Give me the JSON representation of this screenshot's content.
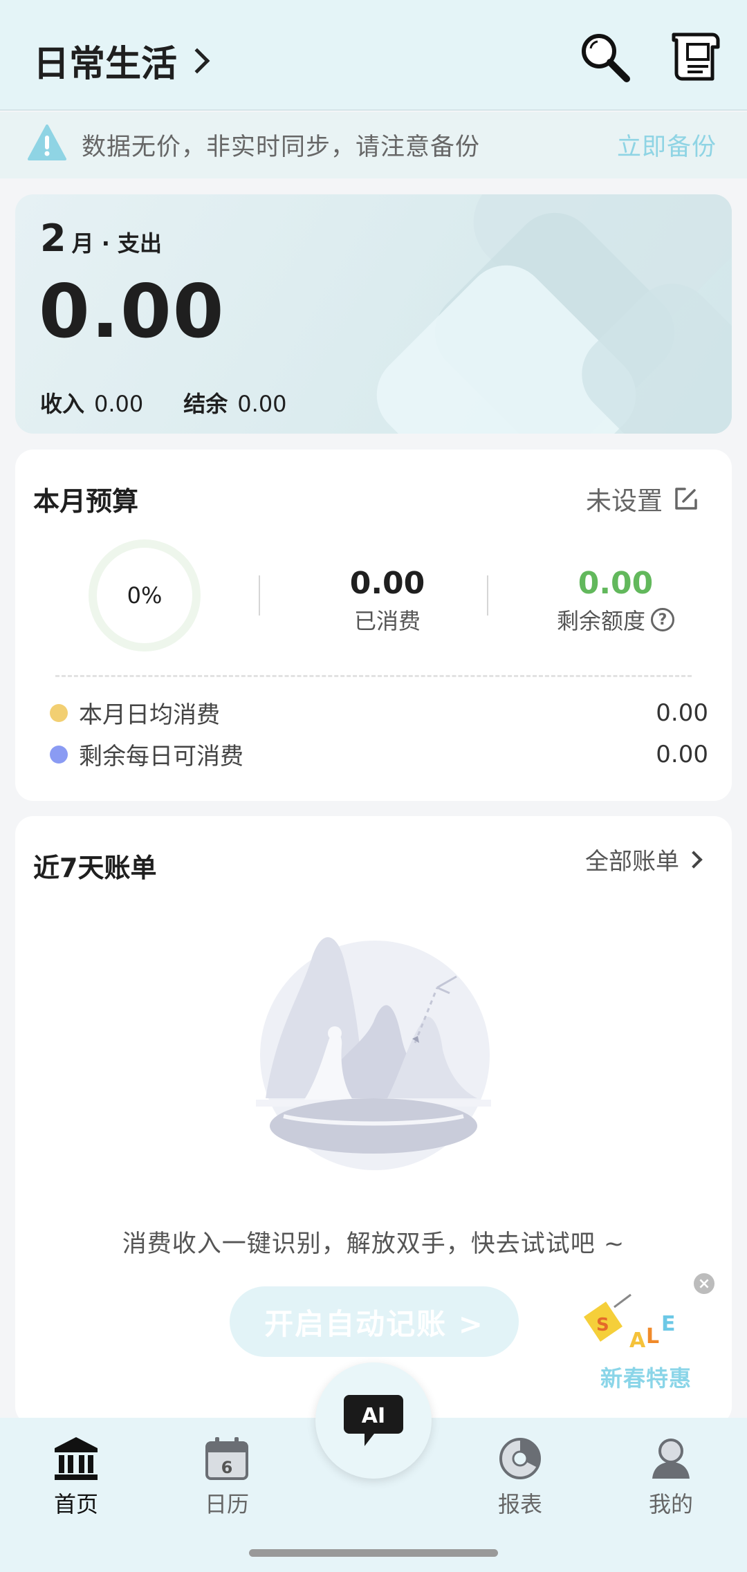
{
  "header": {
    "book_title": "日常生活"
  },
  "notice": {
    "text": "数据无价，非实时同步，请注意备份",
    "action": "立即备份"
  },
  "summary": {
    "month": "2",
    "month_label": "月 · 支出",
    "expense": "0.00",
    "income_label": "收入",
    "income": "0.00",
    "balance_label": "结余",
    "balance": "0.00"
  },
  "budget": {
    "title": "本月预算",
    "status": "未设置",
    "progress_percent": "0%",
    "spent": "0.00",
    "spent_label": "已消费",
    "remaining": "0.00",
    "remaining_label": "剩余额度",
    "help_glyph": "?",
    "rows": [
      {
        "label": "本月日均消费",
        "value": "0.00"
      },
      {
        "label": "剩余每日可消费",
        "value": "0.00"
      }
    ]
  },
  "bills": {
    "title": "近7天账单",
    "more": "全部账单",
    "empty_text": "消费收入一键识别，解放双手，快去试试吧 ~",
    "auto_button": "开启自动记账 >"
  },
  "promo": {
    "label": "新春特惠",
    "close": "×",
    "art_letters": [
      "S",
      "A",
      "L",
      "E"
    ]
  },
  "ai_button": {
    "label": "AI"
  },
  "tabs": [
    {
      "label": "首页",
      "icon": "bank-icon",
      "active": true
    },
    {
      "label": "日历",
      "icon": "calendar-icon",
      "day": "6"
    },
    {
      "label": "报表",
      "icon": "report-icon"
    },
    {
      "label": "我的",
      "icon": "profile-icon"
    }
  ],
  "colors": {
    "accent": "#8fd4e4",
    "header_bg": "#e4f4f7",
    "positive_green": "#62b85c",
    "dot_gold": "#f2cf72",
    "dot_blue": "#8a9bf3"
  }
}
